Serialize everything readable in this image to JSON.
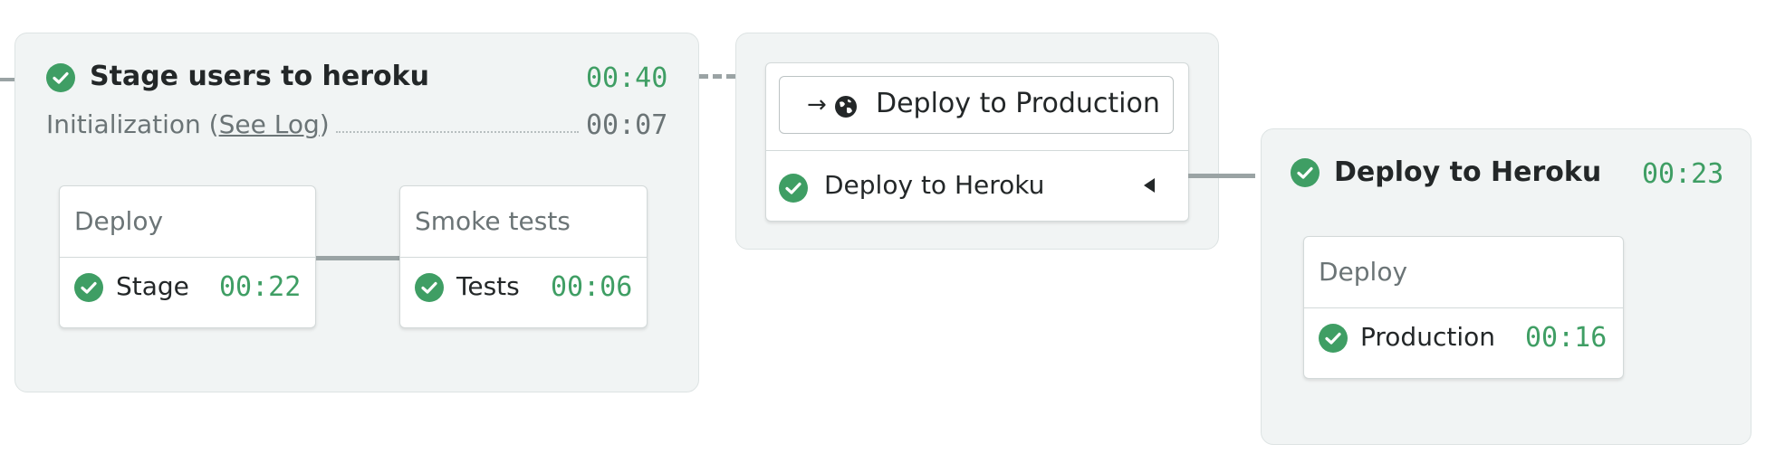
{
  "colors": {
    "success": "#3f9e64",
    "panel": "#f1f4f4",
    "connector": "#9aa3a4"
  },
  "block_stage": {
    "title": "Stage users to heroku",
    "time": "00:40",
    "init_prefix": "Initialization (",
    "init_link": "See Log",
    "init_suffix": ")",
    "init_time": "00:07",
    "jobs": [
      {
        "header": "Deploy",
        "job": "Stage",
        "time": "00:22",
        "icon": "check-circle-icon"
      },
      {
        "header": "Smoke tests",
        "job": "Tests",
        "time": "00:06",
        "icon": "check-circle-icon"
      }
    ]
  },
  "promotion": {
    "button_label": "Deploy to Production",
    "button_icons": [
      "arrow-right-icon",
      "globe-icon"
    ],
    "pipeline": "Deploy to Heroku",
    "expand_icon": "triangle-left-icon"
  },
  "block_deploy": {
    "title": "Deploy to Heroku",
    "time": "00:23",
    "jobs": [
      {
        "header": "Deploy",
        "job": "Production",
        "time": "00:16",
        "icon": "check-circle-icon"
      }
    ]
  }
}
